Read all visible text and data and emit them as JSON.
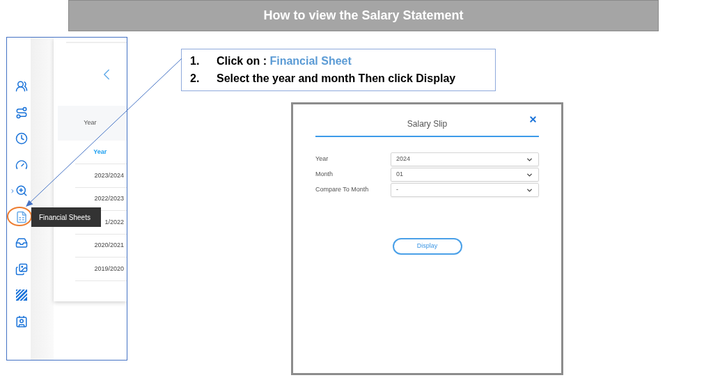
{
  "title": "How to view the Salary Statement",
  "sidebar": {
    "items": [
      {
        "expandable": false,
        "selected": false
      },
      {
        "expandable": false,
        "selected": false
      },
      {
        "expandable": false,
        "selected": false
      },
      {
        "expandable": false,
        "selected": false
      },
      {
        "expandable": true,
        "selected": false
      },
      {
        "expandable": false,
        "selected": true
      },
      {
        "expandable": false,
        "selected": false
      },
      {
        "expandable": false,
        "selected": false
      },
      {
        "expandable": false,
        "selected": false
      },
      {
        "expandable": false,
        "selected": false
      }
    ],
    "tooltip": "Financial Sheets"
  },
  "years_table": {
    "header": "Year",
    "column_heading": "Year",
    "rows": [
      "2023/2024",
      "2022/2023",
      "1/2022",
      "2020/2021",
      "2019/2020"
    ]
  },
  "instructions": [
    {
      "number": "1.",
      "text": "Click on : ",
      "highlight": "Financial Sheet"
    },
    {
      "number": "2.",
      "text": "Select the year and month Then click Display"
    }
  ],
  "dialog": {
    "title": "Salary Slip",
    "fields": [
      {
        "label": "Year",
        "value": "2024"
      },
      {
        "label": "Month",
        "value": "01"
      },
      {
        "label": "Compare To Month",
        "value": "-"
      }
    ],
    "button": "Display"
  }
}
